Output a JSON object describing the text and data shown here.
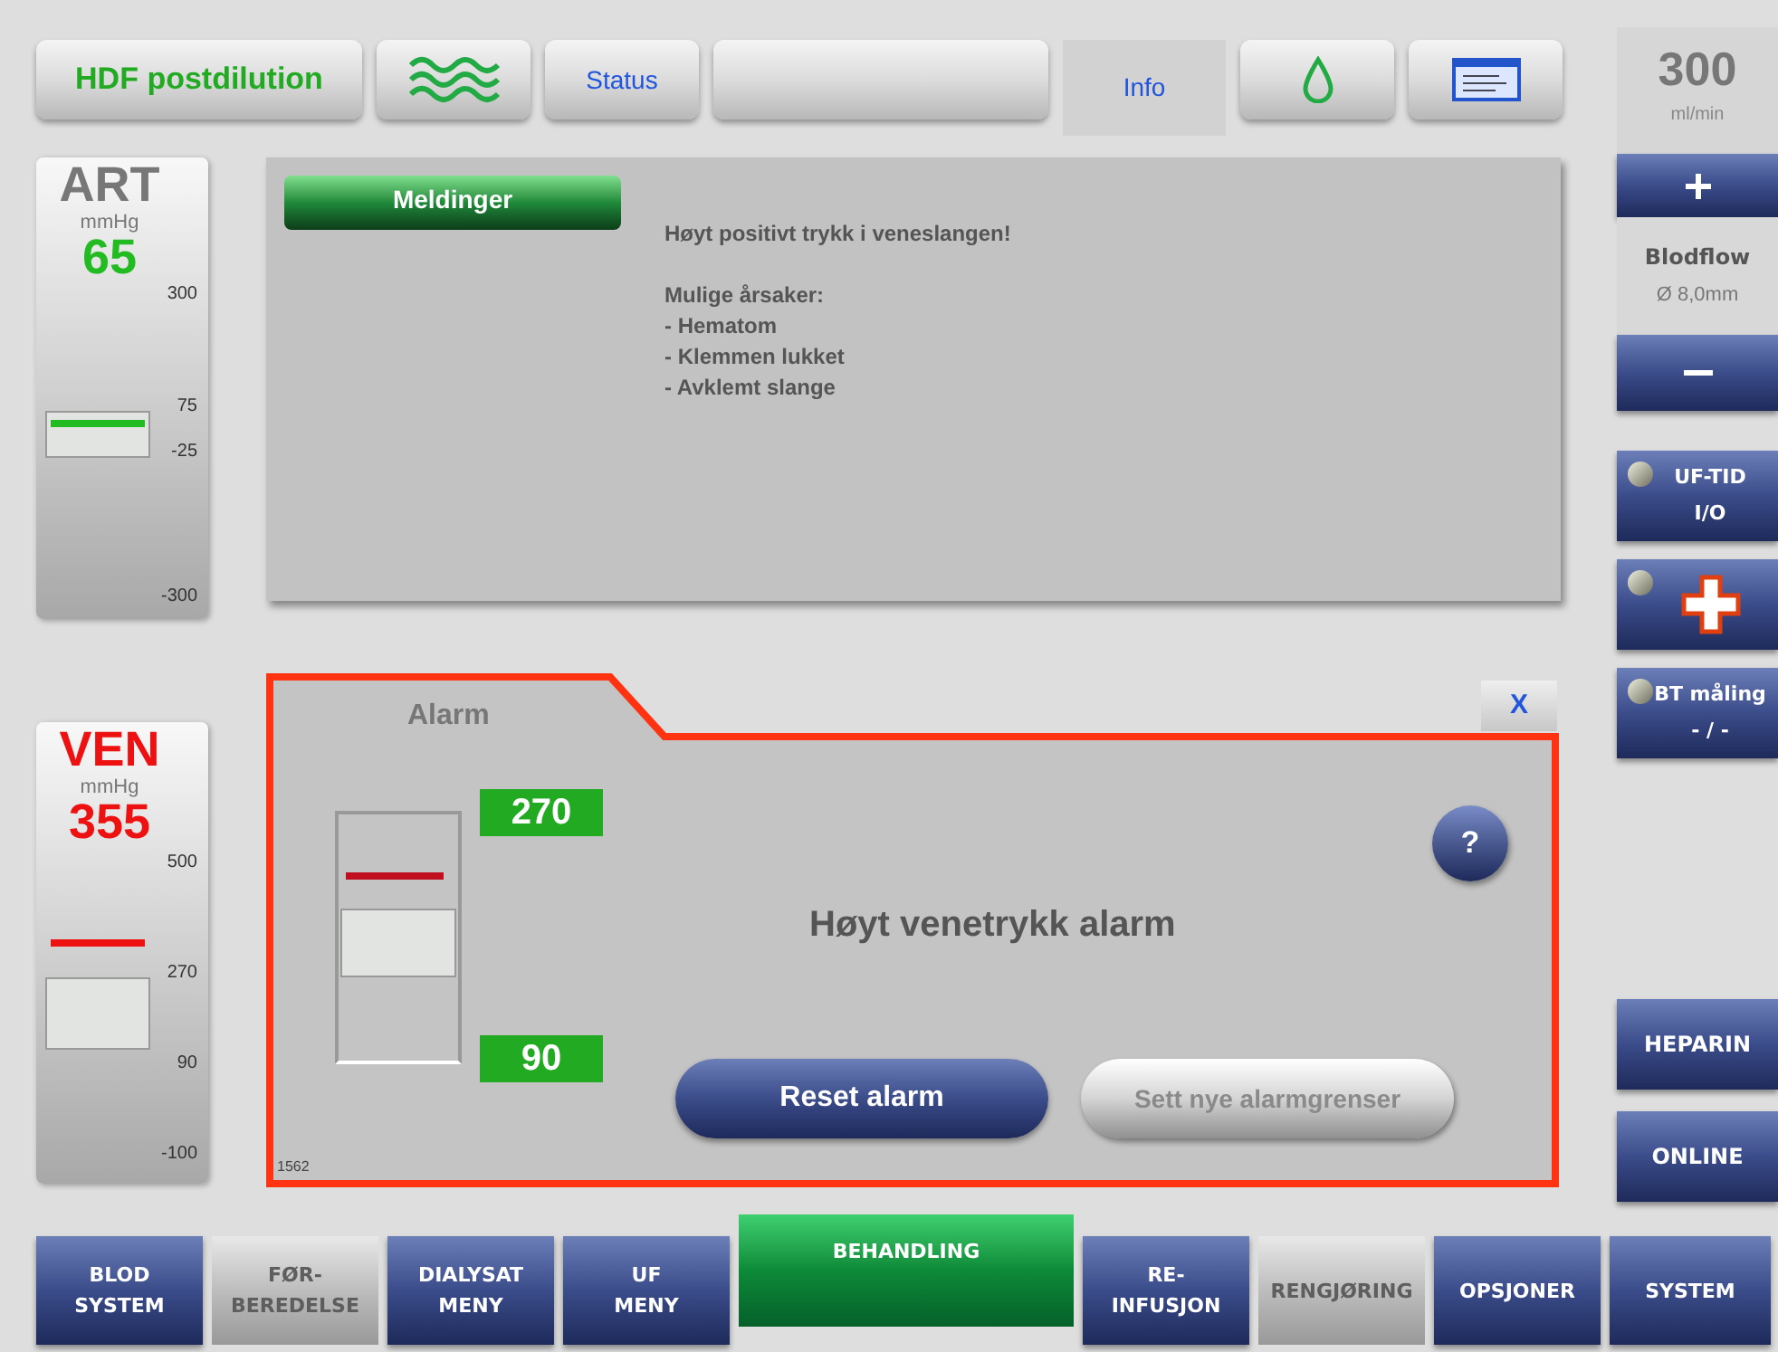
{
  "top_bar": {
    "mode": "HDF postdilution",
    "status": "Status",
    "info": "Info"
  },
  "blood_flow": {
    "value": "300",
    "unit": "ml/min",
    "label": "Blodflow",
    "diameter": "Ø 8,0mm"
  },
  "pressure_gauges": [
    {
      "name": "ART",
      "unit": "mmHg",
      "value": "65",
      "color": "#22bb22",
      "level": 0.43,
      "scale": [
        "300",
        "75",
        "-25",
        "-300"
      ]
    },
    {
      "name": "VEN",
      "unit": "mmHg",
      "value": "355",
      "color": "#ee1111",
      "level": 0.53,
      "scale": [
        "500",
        "270",
        "90",
        "-100"
      ]
    }
  ],
  "messages": {
    "tab": "Meldinger",
    "title": "Høyt positivt trykk i veneslangen!",
    "causes_heading": "Mulige årsaker:",
    "causes": [
      "- Hematom",
      "- Klemmen lukket",
      "- Avklemt slange"
    ]
  },
  "alarm": {
    "tab": "Alarm",
    "close": "X",
    "upper_limit": "270",
    "lower_limit": "90",
    "message": "Høyt venetrykk alarm",
    "help": "?",
    "code": "1562",
    "buttons": [
      {
        "label": "Reset alarm",
        "disabled": false
      },
      {
        "label": "Sett nye alarmgrenser",
        "disabled": true
      }
    ]
  },
  "side_buttons": [
    {
      "kind": "indicator",
      "label": "UF-TID",
      "sublabel": "I/O",
      "on": false
    },
    {
      "kind": "cross",
      "on": false
    },
    {
      "kind": "indicator",
      "label": "BT måling",
      "sublabel": "- / -",
      "on": false
    }
  ],
  "side_menu": [
    "HEPARIN",
    "ONLINE"
  ],
  "nav": [
    {
      "label": "BLOD\nSYSTEM",
      "selected": false,
      "disabled": false
    },
    {
      "label": "FØR-\nBEREDELSE",
      "selected": false,
      "disabled": true
    },
    {
      "label": "DIALYSAT\nMENY",
      "selected": false,
      "disabled": false
    },
    {
      "label": "UF\nMENY",
      "selected": false,
      "disabled": false
    },
    {
      "label": "BEHANDLING",
      "selected": true,
      "disabled": false
    },
    {
      "label": "RE-\nINFUSJON",
      "selected": false,
      "disabled": false
    },
    {
      "label": "RENGJØRING",
      "selected": false,
      "disabled": true
    },
    {
      "label": "OPSJONER",
      "selected": false,
      "disabled": false
    },
    {
      "label": "SYSTEM",
      "selected": false,
      "disabled": false
    }
  ]
}
